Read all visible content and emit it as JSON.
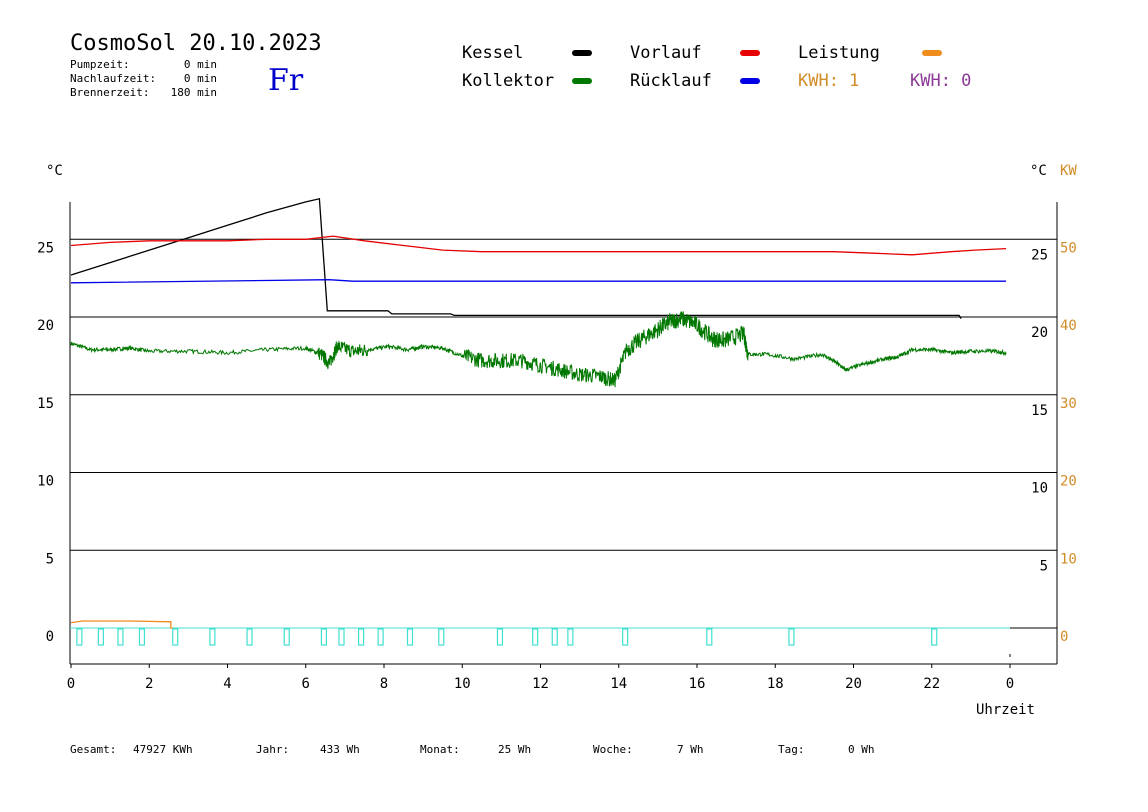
{
  "chart_data": {
    "type": "line",
    "title": "CosmoSol 20.10.2023",
    "day": "Fr",
    "info": [
      {
        "label": "Pumpzeit:",
        "value": "0 min"
      },
      {
        "label": "Nachlaufzeit:",
        "value": "0 min"
      },
      {
        "label": "Brennerzeit:",
        "value": "180 min"
      }
    ],
    "legend": [
      {
        "name": "Kessel",
        "color": "#000000"
      },
      {
        "name": "Kollektor",
        "color": "#007800"
      },
      {
        "name": "Vorlauf",
        "color": "#e60000"
      },
      {
        "name": "Rücklauf",
        "color": "#0000e6"
      },
      {
        "name": "Leistung",
        "color": "#f08c1e"
      }
    ],
    "kwh": [
      {
        "text": "KWH: 1",
        "color": "#d28c28"
      },
      {
        "text": "KWH: 0",
        "color": "#8c3c96"
      }
    ],
    "left_unit": "°C",
    "right_unit": "°C",
    "right_unit2": "KW",
    "xlabel": "Uhrzeit",
    "x_ticks": [
      "0",
      "2",
      "4",
      "6",
      "8",
      "10",
      "12",
      "14",
      "16",
      "18",
      "20",
      "22",
      "0"
    ],
    "y_left_ticks": [
      0,
      5,
      10,
      15,
      20,
      25
    ],
    "y_right_temp_ticks": [
      5,
      10,
      15,
      20,
      25
    ],
    "y_right_kw_ticks": [
      0,
      10,
      20,
      30,
      40,
      50
    ],
    "xlim": [
      0,
      24
    ],
    "ylim": [
      0,
      28
    ],
    "series": [
      {
        "name": "Kessel",
        "color": "#000000",
        "points": [
          [
            0,
            22.7
          ],
          [
            1,
            23.5
          ],
          [
            2,
            24.3
          ],
          [
            3,
            25.1
          ],
          [
            4,
            25.9
          ],
          [
            5,
            26.7
          ],
          [
            6,
            27.4
          ],
          [
            6.35,
            27.6
          ],
          [
            6.55,
            20.4
          ],
          [
            8.1,
            20.4
          ],
          [
            8.2,
            20.2
          ],
          [
            9.7,
            20.2
          ],
          [
            9.8,
            20.1
          ],
          [
            22.7,
            20.1
          ],
          [
            22.75,
            19.9
          ]
        ]
      },
      {
        "name": "Vorlauf",
        "color": "#e60000",
        "points": [
          [
            0,
            24.6
          ],
          [
            1,
            24.8
          ],
          [
            2,
            24.9
          ],
          [
            3,
            24.9
          ],
          [
            4,
            24.9
          ],
          [
            5,
            25.0
          ],
          [
            6,
            25.0
          ],
          [
            6.7,
            25.2
          ],
          [
            7.5,
            24.9
          ],
          [
            8.5,
            24.6
          ],
          [
            9.5,
            24.3
          ],
          [
            10.5,
            24.2
          ],
          [
            12,
            24.2
          ],
          [
            14,
            24.2
          ],
          [
            16,
            24.2
          ],
          [
            18,
            24.2
          ],
          [
            19.5,
            24.2
          ],
          [
            20.5,
            24.1
          ],
          [
            21.5,
            24.0
          ],
          [
            22.5,
            24.2
          ],
          [
            23.1,
            24.3
          ],
          [
            23.9,
            24.4
          ]
        ]
      },
      {
        "name": "Rücklauf",
        "color": "#0000e6",
        "points": [
          [
            0,
            22.2
          ],
          [
            6.6,
            22.4
          ],
          [
            7.2,
            22.3
          ],
          [
            23.9,
            22.3
          ]
        ]
      },
      {
        "name": "Kollektor",
        "color": "#007800",
        "points": [
          [
            0,
            18.3
          ],
          [
            0.5,
            17.9
          ],
          [
            1,
            17.9
          ],
          [
            1.5,
            18.0
          ],
          [
            2,
            17.8
          ],
          [
            3,
            17.8
          ],
          [
            4,
            17.7
          ],
          [
            5,
            17.9
          ],
          [
            6,
            18.0
          ],
          [
            6.4,
            17.6
          ],
          [
            6.6,
            17.0
          ],
          [
            6.8,
            18.1
          ],
          [
            7.2,
            17.8
          ],
          [
            7.6,
            17.9
          ],
          [
            8.1,
            18.1
          ],
          [
            8.6,
            17.9
          ],
          [
            9,
            18.1
          ],
          [
            9.5,
            18.0
          ],
          [
            10,
            17.5
          ],
          [
            10.5,
            17.2
          ],
          [
            11,
            17.2
          ],
          [
            11.5,
            17.2
          ],
          [
            12,
            16.9
          ],
          [
            12.5,
            16.6
          ],
          [
            13,
            16.3
          ],
          [
            13.5,
            16.2
          ],
          [
            13.9,
            15.9
          ],
          [
            14.2,
            17.9
          ],
          [
            14.6,
            18.6
          ],
          [
            15,
            19.2
          ],
          [
            15.3,
            19.7
          ],
          [
            15.6,
            19.9
          ],
          [
            16,
            19.5
          ],
          [
            16.4,
            18.6
          ],
          [
            16.7,
            18.5
          ],
          [
            17.2,
            18.9
          ],
          [
            17.3,
            17.6
          ],
          [
            17.8,
            17.6
          ],
          [
            18.5,
            17.3
          ],
          [
            19.2,
            17.6
          ],
          [
            19.6,
            17.0
          ],
          [
            19.8,
            16.6
          ],
          [
            20.3,
            17.0
          ],
          [
            20.8,
            17.3
          ],
          [
            21.1,
            17.4
          ],
          [
            21.5,
            17.9
          ],
          [
            22,
            17.9
          ],
          [
            22.5,
            17.7
          ],
          [
            23,
            17.8
          ],
          [
            23.6,
            17.8
          ],
          [
            23.9,
            17.7
          ]
        ]
      },
      {
        "name": "Leistung",
        "color": "#f08c1e",
        "points": [
          [
            0,
            0.35
          ],
          [
            0.3,
            0.45
          ],
          [
            1.5,
            0.45
          ],
          [
            2.55,
            0.4
          ],
          [
            2.55,
            0
          ],
          [
            2.6,
            0
          ]
        ]
      }
    ],
    "pump_pulses": [
      0.15,
      0.7,
      1.2,
      1.75,
      2.6,
      3.55,
      4.5,
      5.45,
      6.4,
      6.85,
      7.35,
      7.85,
      8.6,
      9.4,
      10.9,
      11.8,
      12.3,
      12.7,
      14.1,
      16.25,
      18.35,
      22.0
    ],
    "footer": [
      {
        "label": "Gesamt:",
        "value": "47927 KWh"
      },
      {
        "label": "Jahr:",
        "value": "433 Wh"
      },
      {
        "label": "Monat:",
        "value": "25 Wh"
      },
      {
        "label": "Woche:",
        "value": "7 Wh"
      },
      {
        "label": "Tag:",
        "value": "0 Wh"
      }
    ]
  }
}
